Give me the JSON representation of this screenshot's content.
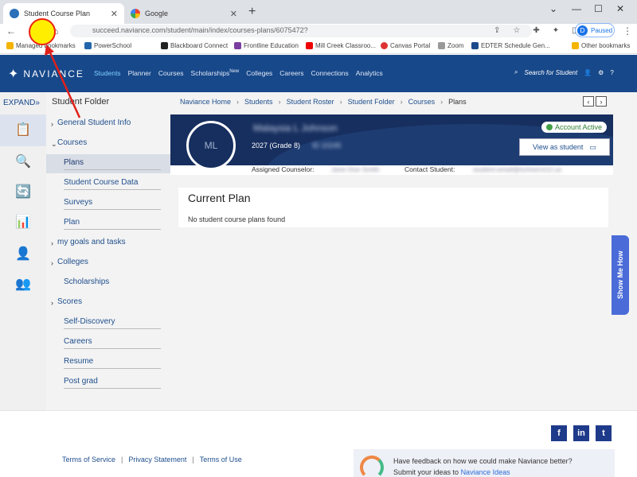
{
  "browser": {
    "tabs": [
      {
        "title": "Student Course Plan",
        "active": true
      },
      {
        "title": "Google",
        "active": false
      }
    ],
    "url": "succeed.naviance.com/student/main/index/courses-plans/6075472?",
    "profile_label": "Paused",
    "profile_initial": "D",
    "bookmarks": [
      "Managed bookmarks",
      "PowerSchool",
      "Blackboard Connect",
      "Frontline Education",
      "Mill Creek Classroo...",
      "Canvas Portal",
      "Zoom",
      "EDTER Schedule Gen...",
      "Other bookmarks"
    ]
  },
  "header": {
    "logo": "NAVIANCE",
    "nav": [
      "Students",
      "Planner",
      "Courses",
      "Scholarships",
      "Colleges",
      "Careers",
      "Connections",
      "Analytics"
    ],
    "nav_sup": "New",
    "search_label": "Search for Student"
  },
  "rail": {
    "expand": "EXPAND»"
  },
  "folder": {
    "title": "Student Folder",
    "items": [
      {
        "label": "General Student Info",
        "chev": "›"
      },
      {
        "label": "Courses",
        "chev": "⌄"
      },
      {
        "label": "Plans",
        "chev": ""
      },
      {
        "label": "Student Course Data",
        "chev": ""
      },
      {
        "label": "Surveys",
        "chev": ""
      },
      {
        "label": "Plan",
        "chev": ""
      },
      {
        "label": "my goals and tasks",
        "chev": "›"
      },
      {
        "label": "Colleges",
        "chev": "›"
      },
      {
        "label": "Scholarships",
        "chev": ""
      },
      {
        "label": "Scores",
        "chev": "›"
      },
      {
        "label": "Self-Discovery",
        "chev": ""
      },
      {
        "label": "Careers",
        "chev": ""
      },
      {
        "label": "Resume",
        "chev": ""
      },
      {
        "label": "Post grad",
        "chev": ""
      }
    ]
  },
  "breadcrumb": [
    "Naviance Home",
    "Students",
    "Student Roster",
    "Student Folder",
    "Courses",
    "Plans"
  ],
  "student": {
    "initials": "ML",
    "name": "Malaysia L Johnson",
    "grade": "2027 (Grade 8)",
    "id": "ID 10245",
    "status": "Account Active",
    "view_as": "View as student",
    "counselor_label": "Assigned Counselor:",
    "counselor_value": "Jane Doe Smith",
    "contact_label": "Contact Student:",
    "contact_value": "student.email@school.k12.us"
  },
  "plan": {
    "title": "Current Plan",
    "empty": "No student course plans found"
  },
  "show_me": "Show Me How",
  "footer": {
    "links": [
      "Terms of Service",
      "Privacy Statement",
      "Terms of Use"
    ],
    "social": [
      "f",
      "in",
      "t"
    ],
    "feedback_q": "Have feedback on how we could make Naviance better?",
    "feedback_pre": "Submit your ideas to",
    "feedback_link": "Naviance Ideas"
  }
}
